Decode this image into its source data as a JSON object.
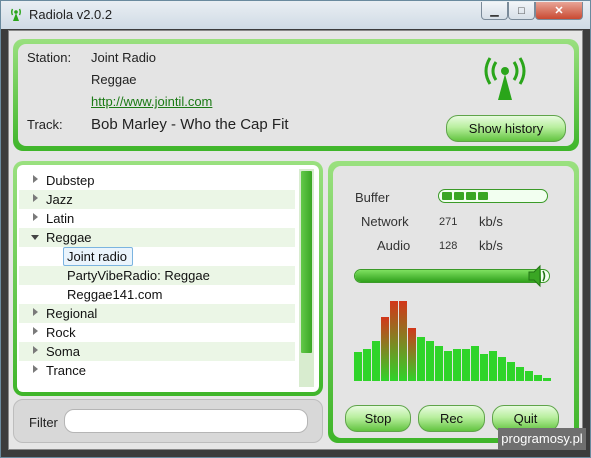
{
  "window": {
    "title": "Radiola v2.0.2",
    "minimize_glyph": "▁",
    "maximize_glyph": "□",
    "close_glyph": "✕"
  },
  "info": {
    "station_label": "Station:",
    "station_name": "Joint Radio",
    "genre": "Reggae",
    "url": "http://www.jointil.com",
    "track_label": "Track:",
    "track": "Bob Marley - Who the Cap Fit",
    "show_history": "Show history",
    "logo_icon": "radio-tower-icon"
  },
  "tree": {
    "items": [
      {
        "label": "Dubstep",
        "type": "collapsed"
      },
      {
        "label": "Jazz",
        "type": "collapsed"
      },
      {
        "label": "Latin",
        "type": "collapsed"
      },
      {
        "label": "Reggae",
        "type": "expanded"
      },
      {
        "label": "Joint radio",
        "type": "child",
        "selected": true
      },
      {
        "label": "PartyVibeRadio: Reggae",
        "type": "child"
      },
      {
        "label": "Reggae141.com",
        "type": "child"
      },
      {
        "label": "Regional",
        "type": "collapsed"
      },
      {
        "label": "Rock",
        "type": "collapsed"
      },
      {
        "label": "Soma",
        "type": "collapsed"
      },
      {
        "label": "Trance",
        "type": "collapsed"
      }
    ],
    "scroll_fraction_visible": 0.85
  },
  "filter": {
    "label": "Filter",
    "value": ""
  },
  "stats": {
    "buffer_label": "Buffer",
    "buffer_filled_segments": 4,
    "network_label": "Network",
    "network_value": "271",
    "network_unit": "kb/s",
    "audio_label": "Audio",
    "audio_value": "128",
    "audio_unit": "kb/s",
    "volume_fraction": 0.96,
    "volume_icon": "speaker-icon"
  },
  "spectrum": {
    "levels": [
      0.36,
      0.4,
      0.5,
      0.8,
      1.0,
      1.0,
      0.66,
      0.55,
      0.5,
      0.44,
      0.38,
      0.4,
      0.4,
      0.44,
      0.34,
      0.38,
      0.3,
      0.24,
      0.18,
      0.12,
      0.07,
      0.04
    ]
  },
  "controls": {
    "stop": "Stop",
    "rec": "Rec",
    "quit": "Quit"
  },
  "watermark": "programosy.pl",
  "colors": {
    "accent": "#3fb52a",
    "accent_light": "#9ae07f",
    "peak": "#d2361a"
  }
}
